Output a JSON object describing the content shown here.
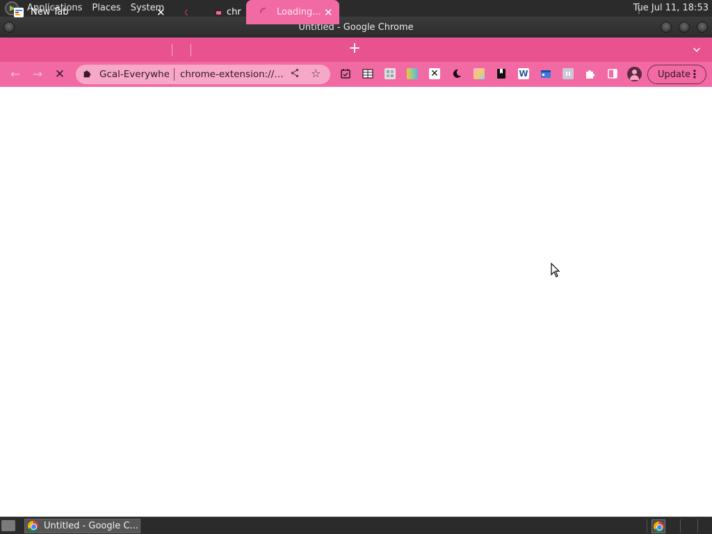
{
  "top_panel": {
    "menus": [
      "Applications",
      "Places",
      "System"
    ],
    "clock": "Tue Jul 11, 18:53"
  },
  "window": {
    "title": "Untitled - Google Chrome"
  },
  "tabs": [
    {
      "label": "New Tab",
      "state": "inactive"
    },
    {
      "label": "",
      "state": "inactive"
    },
    {
      "label": "chr",
      "state": "inactive"
    },
    {
      "label": "Loading...",
      "state": "active"
    }
  ],
  "tabstrip": {
    "new_tab": "+",
    "tab_search": "⌄"
  },
  "toolbar": {
    "back": "←",
    "forward": "→",
    "stop": "✕",
    "omnibox": {
      "site_name": "Gcal-Everywher",
      "url": "chrome-extension://g...",
      "share": "⋖",
      "star": "☆"
    },
    "extensions": [
      "calendar-check-icon",
      "table-icon",
      "grid-icon",
      "gradient-tile-icon",
      "x-icon",
      "moon-icon",
      "colorful-tile-icon",
      "bookmark-black-icon",
      "word-w-icon",
      "calendar-blue-icon",
      "pause-icon",
      "puzzle-icon",
      "side-panel-icon"
    ],
    "update_label": "Update",
    "kebab": "⋮"
  },
  "taskbar": {
    "window_item": "Untitled - Google C..."
  },
  "colors": {
    "tabstrip": "#e8528f",
    "toolbar": "#f26aa4",
    "omnibox": "#f7a8c9",
    "panel": "#2b2b2b"
  }
}
